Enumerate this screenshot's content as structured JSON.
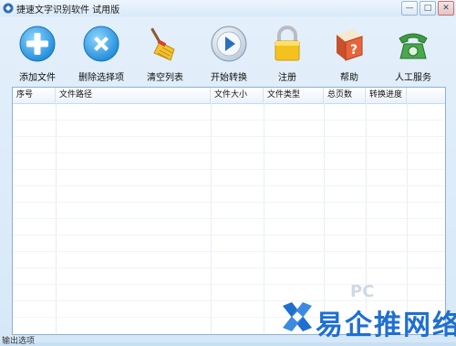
{
  "window": {
    "title": "捷速文字识别软件 试用版"
  },
  "toolbar": {
    "buttons": [
      {
        "label": "添加文件",
        "icon": "add-icon"
      },
      {
        "label": "删除选择项",
        "icon": "delete-icon"
      },
      {
        "label": "清空列表",
        "icon": "broom-icon"
      },
      {
        "label": "开始转换",
        "icon": "play-icon"
      },
      {
        "label": "注册",
        "icon": "lock-icon"
      },
      {
        "label": "帮助",
        "icon": "help-book-icon"
      },
      {
        "label": "人工服务",
        "icon": "phone-icon"
      }
    ]
  },
  "file_table": {
    "columns": [
      "序号",
      "文件路径",
      "文件大小",
      "文件类型",
      "总页数",
      "转换进度"
    ],
    "rows": []
  },
  "footer": {
    "output_options_label": "输出选项"
  },
  "watermark": {
    "text": "易企推网络",
    "faint_text": "PC"
  },
  "colors": {
    "accent": "#1f6fd1",
    "window_bg": "#d6e8f8",
    "border": "#8fb0cf"
  }
}
